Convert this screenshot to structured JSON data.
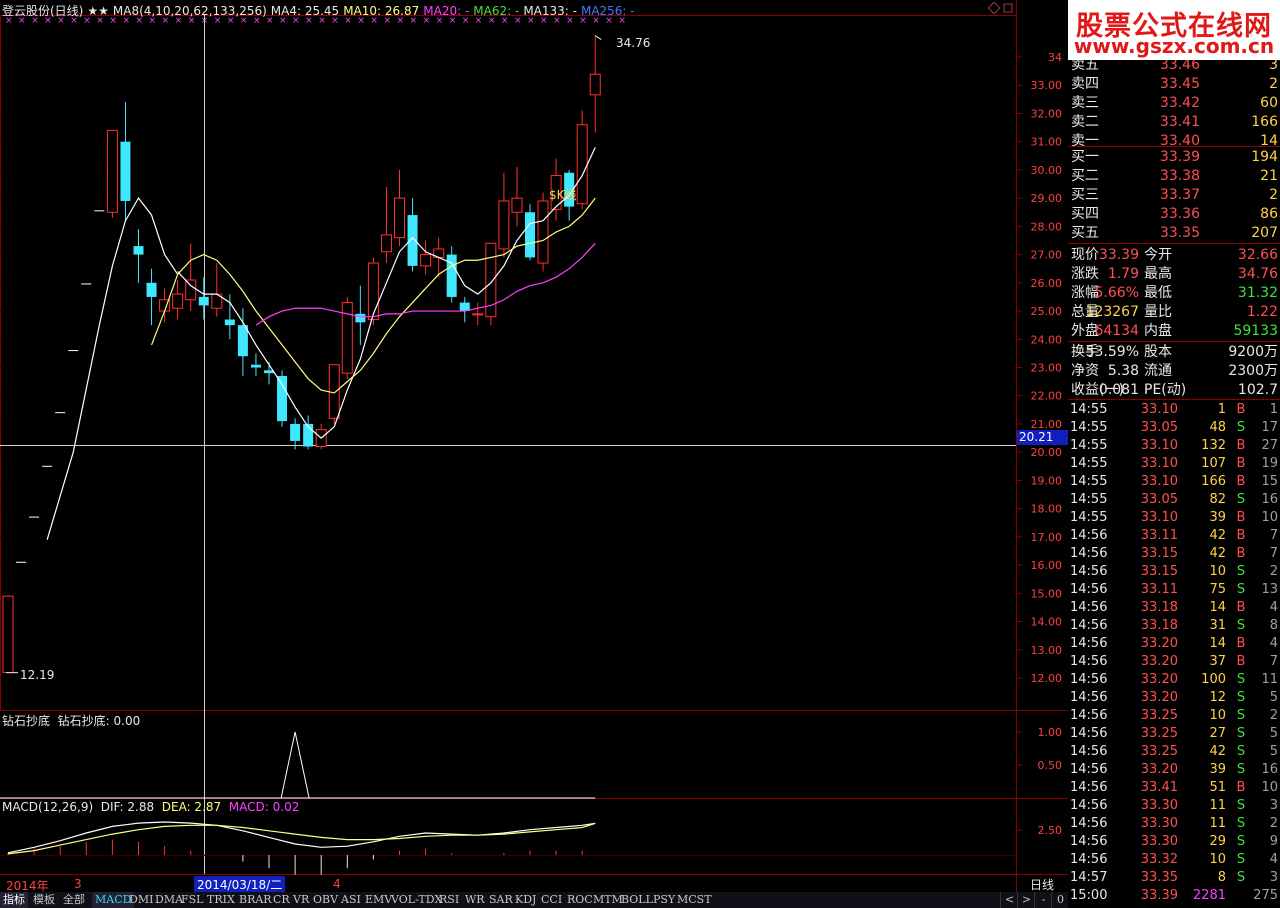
{
  "header": {
    "stock": "登云股份(日线)",
    "stars": "★★",
    "ma_def": "MA8(4,10,20,62,133,256)",
    "ma4": "MA4: 25.45",
    "ma10": "MA10: 26.87",
    "ma20": "MA20: -",
    "ma62": "MA62: -",
    "ma133": "MA133: -",
    "ma256": "MA256: -"
  },
  "chart": {
    "high_label": "34.76",
    "low_label": "12.19",
    "cross_price": "20.21",
    "kline_tag": "$K线",
    "price_axis": [
      "34",
      "33.00",
      "32.00",
      "31.00",
      "30.00",
      "29.00",
      "28.00",
      "27.00",
      "26.00",
      "25.00",
      "24.00",
      "23.00",
      "22.00",
      "21.00",
      "20.00",
      "19.00",
      "18.00",
      "17.00",
      "16.00",
      "15.00",
      "14.00",
      "13.00",
      "12.00"
    ],
    "ind1_title": "钻石抄底",
    "ind1_value": "钻石抄底: 0.00",
    "ind1_axis": [
      "1.00",
      "0.50"
    ],
    "macd_title": "MACD(12,26,9)",
    "macd_dif": "DIF: 2.88",
    "macd_dea": "DEA: 2.87",
    "macd_val": "MACD: 0.02",
    "macd_axis": [
      "2.50"
    ],
    "date_year": "2014年",
    "date_m3": "3",
    "date_m4": "4",
    "date_cursor": "2014/03/18/二",
    "period": "日线"
  },
  "tabs": [
    "指标",
    "模板",
    "全部",
    "MACD",
    "DMI",
    "DMA",
    "FSL",
    "TRIX",
    "BRAR",
    "CR",
    "VR",
    "OBV",
    "ASI",
    "EMV",
    "VOL-TDX",
    "RSI",
    "WR",
    "SAR",
    "KDJ",
    "CCI",
    "ROC",
    "MTM",
    "BOLL",
    "PSY",
    "MCST"
  ],
  "nav": [
    "<",
    ">",
    "-",
    "0"
  ],
  "logo": {
    "line1": "股票公式在线网",
    "line2": "www.gszx.com.cn"
  },
  "orderbook": {
    "asks": [
      {
        "label": "卖五",
        "price": "33.46",
        "vol": "3"
      },
      {
        "label": "卖四",
        "price": "33.45",
        "vol": "2"
      },
      {
        "label": "卖三",
        "price": "33.42",
        "vol": "60"
      },
      {
        "label": "卖二",
        "price": "33.41",
        "vol": "166"
      },
      {
        "label": "卖一",
        "price": "33.40",
        "vol": "14"
      }
    ],
    "bids": [
      {
        "label": "买一",
        "price": "33.39",
        "vol": "194"
      },
      {
        "label": "买二",
        "price": "33.38",
        "vol": "21"
      },
      {
        "label": "买三",
        "price": "33.37",
        "vol": "2"
      },
      {
        "label": "买四",
        "price": "33.36",
        "vol": "86"
      },
      {
        "label": "买五",
        "price": "33.35",
        "vol": "207"
      }
    ]
  },
  "quote": [
    {
      "k1": "现价",
      "v1": "33.39",
      "k2": "今开",
      "v2": "32.66",
      "c1": "red",
      "c2": "red"
    },
    {
      "k1": "涨跌",
      "v1": "1.79",
      "k2": "最高",
      "v2": "34.76",
      "c1": "red",
      "c2": "red"
    },
    {
      "k1": "涨幅",
      "v1": "5.66%",
      "k2": "最低",
      "v2": "31.32",
      "c1": "red",
      "c2": "grn"
    },
    {
      "k1": "总量",
      "v1": "123267",
      "k2": "量比",
      "v2": "1.22",
      "c1": "yel",
      "c2": "red"
    },
    {
      "k1": "外盘",
      "v1": "64134",
      "k2": "内盘",
      "v2": "59133",
      "c1": "red",
      "c2": "grn"
    },
    {
      "k1": "换手",
      "v1": "53.59%",
      "k2": "股本",
      "v2": "9200万",
      "c1": "wht",
      "c2": "wht"
    },
    {
      "k1": "净资",
      "v1": "5.38",
      "k2": "流通",
      "v2": "2300万",
      "c1": "wht",
      "c2": "wht"
    },
    {
      "k1": "收益(一)",
      "v1": "0.081",
      "k2": "PE(动)",
      "v2": "102.7",
      "c1": "wht",
      "c2": "wht"
    }
  ],
  "ticks": [
    {
      "t": "14:55",
      "p": "33.10",
      "v": "1",
      "s": "B",
      "n": "1"
    },
    {
      "t": "14:55",
      "p": "33.05",
      "v": "48",
      "s": "S",
      "n": "17"
    },
    {
      "t": "14:55",
      "p": "33.10",
      "v": "132",
      "s": "B",
      "n": "27"
    },
    {
      "t": "14:55",
      "p": "33.10",
      "v": "107",
      "s": "B",
      "n": "19"
    },
    {
      "t": "14:55",
      "p": "33.10",
      "v": "166",
      "s": "B",
      "n": "15"
    },
    {
      "t": "14:55",
      "p": "33.05",
      "v": "82",
      "s": "S",
      "n": "16"
    },
    {
      "t": "14:55",
      "p": "33.10",
      "v": "39",
      "s": "B",
      "n": "10"
    },
    {
      "t": "14:56",
      "p": "33.11",
      "v": "42",
      "s": "B",
      "n": "7"
    },
    {
      "t": "14:56",
      "p": "33.15",
      "v": "42",
      "s": "B",
      "n": "7"
    },
    {
      "t": "14:56",
      "p": "33.15",
      "v": "10",
      "s": "S",
      "n": "2"
    },
    {
      "t": "14:56",
      "p": "33.11",
      "v": "75",
      "s": "S",
      "n": "13"
    },
    {
      "t": "14:56",
      "p": "33.18",
      "v": "14",
      "s": "B",
      "n": "4"
    },
    {
      "t": "14:56",
      "p": "33.18",
      "v": "31",
      "s": "S",
      "n": "8"
    },
    {
      "t": "14:56",
      "p": "33.20",
      "v": "14",
      "s": "B",
      "n": "4"
    },
    {
      "t": "14:56",
      "p": "33.20",
      "v": "37",
      "s": "B",
      "n": "7"
    },
    {
      "t": "14:56",
      "p": "33.20",
      "v": "100",
      "s": "S",
      "n": "11"
    },
    {
      "t": "14:56",
      "p": "33.20",
      "v": "12",
      "s": "S",
      "n": "5"
    },
    {
      "t": "14:56",
      "p": "33.25",
      "v": "10",
      "s": "S",
      "n": "2"
    },
    {
      "t": "14:56",
      "p": "33.25",
      "v": "27",
      "s": "S",
      "n": "5"
    },
    {
      "t": "14:56",
      "p": "33.25",
      "v": "42",
      "s": "S",
      "n": "5"
    },
    {
      "t": "14:56",
      "p": "33.20",
      "v": "39",
      "s": "S",
      "n": "16"
    },
    {
      "t": "14:56",
      "p": "33.41",
      "v": "51",
      "s": "B",
      "n": "10"
    },
    {
      "t": "14:56",
      "p": "33.30",
      "v": "11",
      "s": "S",
      "n": "3"
    },
    {
      "t": "14:56",
      "p": "33.30",
      "v": "11",
      "s": "S",
      "n": "2"
    },
    {
      "t": "14:56",
      "p": "33.30",
      "v": "29",
      "s": "S",
      "n": "9"
    },
    {
      "t": "14:56",
      "p": "33.32",
      "v": "10",
      "s": "S",
      "n": "4"
    },
    {
      "t": "14:57",
      "p": "33.35",
      "v": "8",
      "s": "S",
      "n": "3"
    },
    {
      "t": "15:00",
      "p": "33.39",
      "v": "2281",
      "s": "",
      "n": "275"
    }
  ],
  "colors": {
    "up": "#ff3030",
    "down": "#40e8ff",
    "grid": "#8a0000",
    "ma4": "#ffffff",
    "ma10": "#ffff80",
    "ma20": "#ff40ff"
  },
  "candles": [
    {
      "d": "2014-01-07",
      "o": 12.19,
      "c": 14.9,
      "h": 14.9,
      "l": 12.19
    },
    {
      "d": "2014-01-08",
      "o": 16.1,
      "c": 16.1,
      "h": 16.1,
      "l": 16.1
    },
    {
      "d": "2014-01-09",
      "o": 17.7,
      "c": 17.7,
      "h": 17.7,
      "l": 17.7
    },
    {
      "d": "2014-01-10",
      "o": 19.5,
      "c": 19.5,
      "h": 19.5,
      "l": 19.5
    },
    {
      "d": "2014-01-13",
      "o": 21.4,
      "c": 21.4,
      "h": 21.4,
      "l": 21.4
    },
    {
      "d": "2014-01-14",
      "o": 23.6,
      "c": 23.6,
      "h": 23.6,
      "l": 23.6
    },
    {
      "d": "2014-01-15",
      "o": 25.96,
      "c": 25.96,
      "h": 25.96,
      "l": 25.96
    },
    {
      "d": "2014-01-16",
      "o": 28.55,
      "c": 28.55,
      "h": 28.55,
      "l": 28.55
    },
    {
      "d": "2014-01-17",
      "o": 28.5,
      "c": 31.4,
      "h": 31.4,
      "l": 28.3
    },
    {
      "d": "2014-01-20",
      "o": 31.0,
      "c": 28.9,
      "h": 32.4,
      "l": 28.2
    },
    {
      "d": "2014-01-21",
      "o": 27.3,
      "c": 27.0,
      "h": 27.9,
      "l": 26.0
    },
    {
      "d": "2014-01-22",
      "o": 26.0,
      "c": 25.5,
      "h": 26.5,
      "l": 24.5
    },
    {
      "d": "2014-01-23",
      "o": 25.0,
      "c": 25.4,
      "h": 25.8,
      "l": 24.6
    },
    {
      "d": "2014-01-24",
      "o": 25.1,
      "c": 25.6,
      "h": 26.1,
      "l": 24.7
    },
    {
      "d": "2014-01-27",
      "o": 25.4,
      "c": 26.1,
      "h": 27.4,
      "l": 25.0
    },
    {
      "d": "2014-01-28",
      "o": 25.5,
      "c": 25.2,
      "h": 26.2,
      "l": 24.7
    },
    {
      "d": "2014-01-29",
      "o": 25.1,
      "c": 25.6,
      "h": 26.7,
      "l": 24.8
    },
    {
      "d": "2014-01-30",
      "o": 24.7,
      "c": 24.5,
      "h": 25.6,
      "l": 24.0
    },
    {
      "d": "2014-02-07",
      "o": 24.5,
      "c": 23.4,
      "h": 25.1,
      "l": 22.7
    },
    {
      "d": "2014-02-10",
      "o": 23.1,
      "c": 23.0,
      "h": 23.5,
      "l": 22.7
    },
    {
      "d": "2014-02-11",
      "o": 22.9,
      "c": 22.8,
      "h": 23.2,
      "l": 22.4
    },
    {
      "d": "2014-02-12",
      "o": 22.7,
      "c": 21.1,
      "h": 22.9,
      "l": 20.9
    },
    {
      "d": "2014-02-13",
      "o": 21.0,
      "c": 20.4,
      "h": 21.2,
      "l": 20.1
    },
    {
      "d": "2014-02-14",
      "o": 21.0,
      "c": 20.2,
      "h": 21.3,
      "l": 20.1
    },
    {
      "d": "2014-02-17",
      "o": 20.2,
      "c": 20.8,
      "h": 21.0,
      "l": 20.1
    },
    {
      "d": "2014-02-18",
      "o": 21.2,
      "c": 23.1,
      "h": 23.1,
      "l": 21.0
    },
    {
      "d": "2014-02-19",
      "o": 22.8,
      "c": 25.3,
      "h": 25.5,
      "l": 22.6
    },
    {
      "d": "2014-02-20",
      "o": 24.9,
      "c": 24.6,
      "h": 25.9,
      "l": 23.8
    },
    {
      "d": "2014-02-21",
      "o": 24.7,
      "c": 26.7,
      "h": 26.9,
      "l": 24.5
    },
    {
      "d": "2014-02-24",
      "o": 27.1,
      "c": 27.7,
      "h": 29.4,
      "l": 26.7
    },
    {
      "d": "2014-02-25",
      "o": 27.6,
      "c": 29.0,
      "h": 30.0,
      "l": 27.3
    },
    {
      "d": "2014-02-26",
      "o": 28.4,
      "c": 26.6,
      "h": 29.0,
      "l": 26.4
    },
    {
      "d": "2014-02-27",
      "o": 26.6,
      "c": 27.0,
      "h": 27.5,
      "l": 26.3
    },
    {
      "d": "2014-02-28",
      "o": 26.9,
      "c": 27.2,
      "h": 27.6,
      "l": 26.2
    },
    {
      "d": "2014-03-03",
      "o": 27.0,
      "c": 25.5,
      "h": 27.3,
      "l": 25.3
    },
    {
      "d": "2014-03-04",
      "o": 25.3,
      "c": 25.0,
      "h": 25.5,
      "l": 24.6
    },
    {
      "d": "2014-03-05",
      "o": 24.9,
      "c": 24.9,
      "h": 25.3,
      "l": 24.5
    },
    {
      "d": "2014-03-06",
      "o": 24.8,
      "c": 27.4,
      "h": 27.4,
      "l": 24.5
    },
    {
      "d": "2014-03-07",
      "o": 27.2,
      "c": 28.9,
      "h": 29.9,
      "l": 26.9
    },
    {
      "d": "2014-03-10",
      "o": 28.5,
      "c": 29.0,
      "h": 30.1,
      "l": 28.0
    },
    {
      "d": "2014-03-11",
      "o": 28.5,
      "c": 26.9,
      "h": 28.8,
      "l": 26.8
    },
    {
      "d": "2014-03-12",
      "o": 26.7,
      "c": 28.9,
      "h": 29.2,
      "l": 26.4
    },
    {
      "d": "2014-03-13",
      "o": 28.6,
      "c": 29.8,
      "h": 30.4,
      "l": 28.2
    },
    {
      "d": "2014-03-14",
      "o": 29.9,
      "c": 28.7,
      "h": 30.0,
      "l": 28.2
    },
    {
      "d": "2014-03-17",
      "o": 28.8,
      "c": 31.6,
      "h": 32.1,
      "l": 28.6
    },
    {
      "d": "2014-03-18",
      "o": 32.66,
      "c": 33.39,
      "h": 34.76,
      "l": 31.32
    }
  ],
  "ma4_line": [
    [
      8,
      22.8
    ],
    [
      9,
      25.6
    ],
    [
      10,
      28.0
    ],
    [
      11,
      28.9
    ],
    [
      12,
      27.8
    ],
    [
      13,
      26.4
    ],
    [
      14,
      25.9
    ],
    [
      15,
      25.6
    ],
    [
      16,
      25.6
    ],
    [
      17,
      25.3
    ],
    [
      18,
      24.6
    ],
    [
      19,
      23.8
    ],
    [
      20,
      23.1
    ],
    [
      21,
      22.4
    ],
    [
      22,
      21.6
    ],
    [
      23,
      20.9
    ],
    [
      24,
      20.5
    ],
    [
      25,
      20.9
    ],
    [
      26,
      22.2
    ],
    [
      27,
      23.3
    ],
    [
      28,
      24.9
    ],
    [
      29,
      26.0
    ],
    [
      30,
      27.1
    ],
    [
      31,
      27.6
    ],
    [
      32,
      27.1
    ],
    [
      33,
      26.9
    ],
    [
      34,
      26.7
    ],
    [
      35,
      25.9
    ],
    [
      36,
      25.6
    ],
    [
      37,
      26.0
    ],
    [
      38,
      26.6
    ],
    [
      39,
      27.5
    ],
    [
      40,
      28.1
    ],
    [
      41,
      28.2
    ],
    [
      42,
      28.7
    ],
    [
      43,
      29.1
    ],
    [
      44,
      29.8
    ],
    [
      45,
      30.8
    ]
  ],
  "ma10_line": [
    [
      11,
      23.8
    ],
    [
      12,
      25.0
    ],
    [
      13,
      26.3
    ],
    [
      14,
      26.8
    ],
    [
      15,
      27.0
    ],
    [
      16,
      26.8
    ],
    [
      17,
      26.3
    ],
    [
      18,
      25.7
    ],
    [
      19,
      25.0
    ],
    [
      20,
      24.4
    ],
    [
      21,
      23.8
    ],
    [
      22,
      23.2
    ],
    [
      23,
      22.6
    ],
    [
      24,
      22.2
    ],
    [
      25,
      22.1
    ],
    [
      26,
      22.5
    ],
    [
      27,
      22.9
    ],
    [
      28,
      23.5
    ],
    [
      29,
      24.2
    ],
    [
      30,
      24.8
    ],
    [
      31,
      25.3
    ],
    [
      32,
      25.8
    ],
    [
      33,
      26.3
    ],
    [
      34,
      26.6
    ],
    [
      35,
      26.8
    ],
    [
      36,
      26.8
    ],
    [
      37,
      26.9
    ],
    [
      38,
      27.0
    ],
    [
      39,
      27.3
    ],
    [
      40,
      27.4
    ],
    [
      41,
      27.5
    ],
    [
      42,
      27.8
    ],
    [
      43,
      28.0
    ],
    [
      44,
      28.4
    ],
    [
      45,
      29.0
    ]
  ],
  "ma20_line": [
    [
      19,
      24.5
    ],
    [
      20,
      24.8
    ],
    [
      21,
      25.0
    ],
    [
      22,
      25.1
    ],
    [
      23,
      25.1
    ],
    [
      24,
      25.1
    ],
    [
      25,
      25.0
    ],
    [
      26,
      24.9
    ],
    [
      27,
      24.8
    ],
    [
      28,
      24.8
    ],
    [
      29,
      24.9
    ],
    [
      30,
      24.9
    ],
    [
      31,
      25.0
    ],
    [
      32,
      25.0
    ],
    [
      33,
      25.0
    ],
    [
      34,
      25.0
    ],
    [
      35,
      25.0
    ],
    [
      36,
      25.1
    ],
    [
      37,
      25.2
    ],
    [
      38,
      25.4
    ],
    [
      39,
      25.7
    ],
    [
      40,
      25.9
    ],
    [
      41,
      26.0
    ],
    [
      42,
      26.2
    ],
    [
      43,
      26.5
    ],
    [
      44,
      26.9
    ],
    [
      45,
      27.4
    ]
  ],
  "macd_dif_line": [
    [
      0,
      0.2
    ],
    [
      2,
      0.7
    ],
    [
      4,
      1.3
    ],
    [
      6,
      2.0
    ],
    [
      8,
      2.6
    ],
    [
      10,
      2.9
    ],
    [
      12,
      3.0
    ],
    [
      14,
      2.9
    ],
    [
      16,
      2.7
    ],
    [
      18,
      2.2
    ],
    [
      20,
      1.6
    ],
    [
      22,
      1.0
    ],
    [
      24,
      0.7
    ],
    [
      26,
      0.8
    ],
    [
      28,
      1.2
    ],
    [
      30,
      1.7
    ],
    [
      32,
      2.0
    ],
    [
      34,
      1.9
    ],
    [
      36,
      1.8
    ],
    [
      38,
      2.0
    ],
    [
      40,
      2.3
    ],
    [
      42,
      2.5
    ],
    [
      44,
      2.7
    ],
    [
      45,
      2.88
    ]
  ],
  "macd_dea_line": [
    [
      0,
      0.1
    ],
    [
      2,
      0.4
    ],
    [
      4,
      0.9
    ],
    [
      6,
      1.4
    ],
    [
      8,
      1.9
    ],
    [
      10,
      2.3
    ],
    [
      12,
      2.6
    ],
    [
      14,
      2.7
    ],
    [
      16,
      2.7
    ],
    [
      18,
      2.5
    ],
    [
      20,
      2.2
    ],
    [
      22,
      1.9
    ],
    [
      24,
      1.6
    ],
    [
      26,
      1.4
    ],
    [
      28,
      1.4
    ],
    [
      30,
      1.5
    ],
    [
      32,
      1.7
    ],
    [
      34,
      1.8
    ],
    [
      36,
      1.8
    ],
    [
      38,
      1.9
    ],
    [
      40,
      2.1
    ],
    [
      42,
      2.3
    ],
    [
      44,
      2.5
    ],
    [
      45,
      2.87
    ]
  ],
  "signal_peak_index": 22
}
